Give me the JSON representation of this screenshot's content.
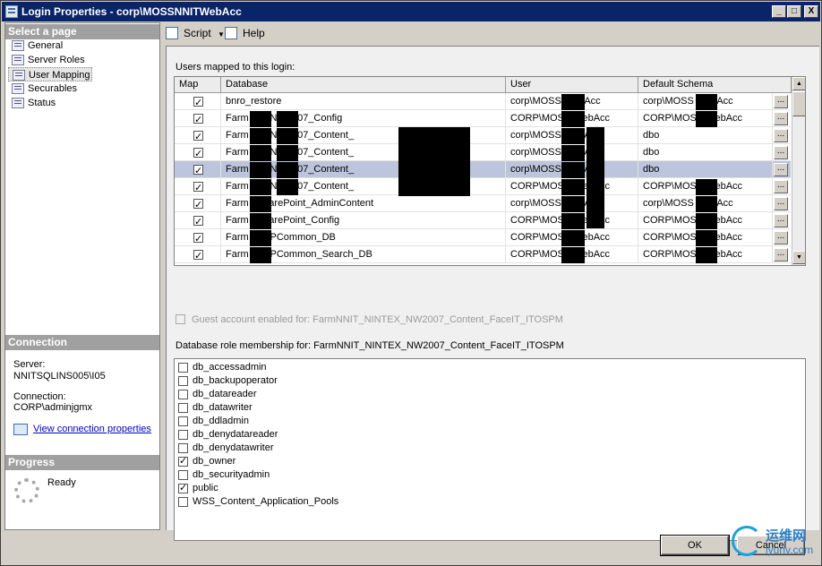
{
  "window": {
    "title": "Login Properties - corp\\MOSSNNITWebAcc",
    "controls": [
      "_",
      "□",
      "X"
    ]
  },
  "sidebar": {
    "select_page_header": "Select a page",
    "pages": [
      {
        "label": "General",
        "selected": false
      },
      {
        "label": "Server Roles",
        "selected": false
      },
      {
        "label": "User Mapping",
        "selected": true
      },
      {
        "label": "Securables",
        "selected": false
      },
      {
        "label": "Status",
        "selected": false
      }
    ],
    "connection_header": "Connection",
    "server_label": "Server:",
    "server_value": "NNITSQLINS005\\I05",
    "connection_label": "Connection:",
    "connection_value": "CORP\\adminjgmx",
    "view_connection_link": "View connection properties",
    "progress_header": "Progress",
    "progress_status": "Ready"
  },
  "toolbar": {
    "script_label": "Script",
    "help_label": "Help"
  },
  "users_mapped": {
    "label": "Users mapped to this login:",
    "columns": [
      "Map",
      "Database",
      "User",
      "Default Schema"
    ],
    "rows": [
      {
        "map": true,
        "database": "bnro_restore",
        "user": "corp\\MOSS WebAcc",
        "schema": "corp\\MOSS WebAcc",
        "selected": false
      },
      {
        "map": true,
        "database": "Farm EX_NW2007_Config",
        "user": "CORP\\MOSS WebAcc",
        "schema": "CORP\\MOSS WebAcc",
        "selected": false
      },
      {
        "map": true,
        "database": "Farm EX_NW2007_Content_",
        "user": "corp\\MOSS WebAcc",
        "schema": "dbo",
        "selected": false
      },
      {
        "map": true,
        "database": "Farm EX_NW2007_Content_",
        "user": "corp\\MOSS WebAcc",
        "schema": "dbo",
        "selected": false
      },
      {
        "map": true,
        "database": "Farm EX_NW2007_Content_",
        "user": "corp\\MOSS WebAcc",
        "schema": "dbo",
        "selected": true
      },
      {
        "map": true,
        "database": "Farm EX_NW2007_Content_",
        "user": "CORP\\MOSS WebAcc",
        "schema": "CORP\\MOSS WebAcc",
        "selected": false
      },
      {
        "map": true,
        "database": "Farm _SharePoint_AdminContent",
        "user": "corp\\MOSS WebAcc",
        "schema": "corp\\MOSS WebAcc",
        "selected": false
      },
      {
        "map": true,
        "database": "Farm _SharePoint_Config",
        "user": "CORP\\MOSS WebAcc",
        "schema": "CORP\\MOSS WebAcc",
        "selected": false
      },
      {
        "map": true,
        "database": "Farm _SSPCommon_DB",
        "user": "CORP\\MOSS WebAcc",
        "schema": "CORP\\MOSS WebAcc",
        "selected": false
      },
      {
        "map": true,
        "database": "Farm _SSPCommon_Search_DB",
        "user": "CORP\\MOSS WebAcc",
        "schema": "CORP\\MOSS WebAcc",
        "selected": false
      }
    ],
    "ellipsis": "..."
  },
  "guest": {
    "label": "Guest account enabled for: FarmNNIT_NINTEX_NW2007_Content_FaceIT_ITOSPM",
    "checked": false
  },
  "roles": {
    "label": "Database role membership for: FarmNNIT_NINTEX_NW2007_Content_FaceIT_ITOSPM",
    "items": [
      {
        "name": "db_accessadmin",
        "checked": false
      },
      {
        "name": "db_backupoperator",
        "checked": false
      },
      {
        "name": "db_datareader",
        "checked": false
      },
      {
        "name": "db_datawriter",
        "checked": false
      },
      {
        "name": "db_ddladmin",
        "checked": false
      },
      {
        "name": "db_denydatareader",
        "checked": false
      },
      {
        "name": "db_denydatawriter",
        "checked": false
      },
      {
        "name": "db_owner",
        "checked": true
      },
      {
        "name": "db_securityadmin",
        "checked": false
      },
      {
        "name": "public",
        "checked": true
      },
      {
        "name": "WSS_Content_Application_Pools",
        "checked": false
      }
    ]
  },
  "buttons": {
    "ok": "OK",
    "cancel": "Cancel"
  },
  "watermark": {
    "cn": "运维网",
    "en": "iyunv.com"
  }
}
